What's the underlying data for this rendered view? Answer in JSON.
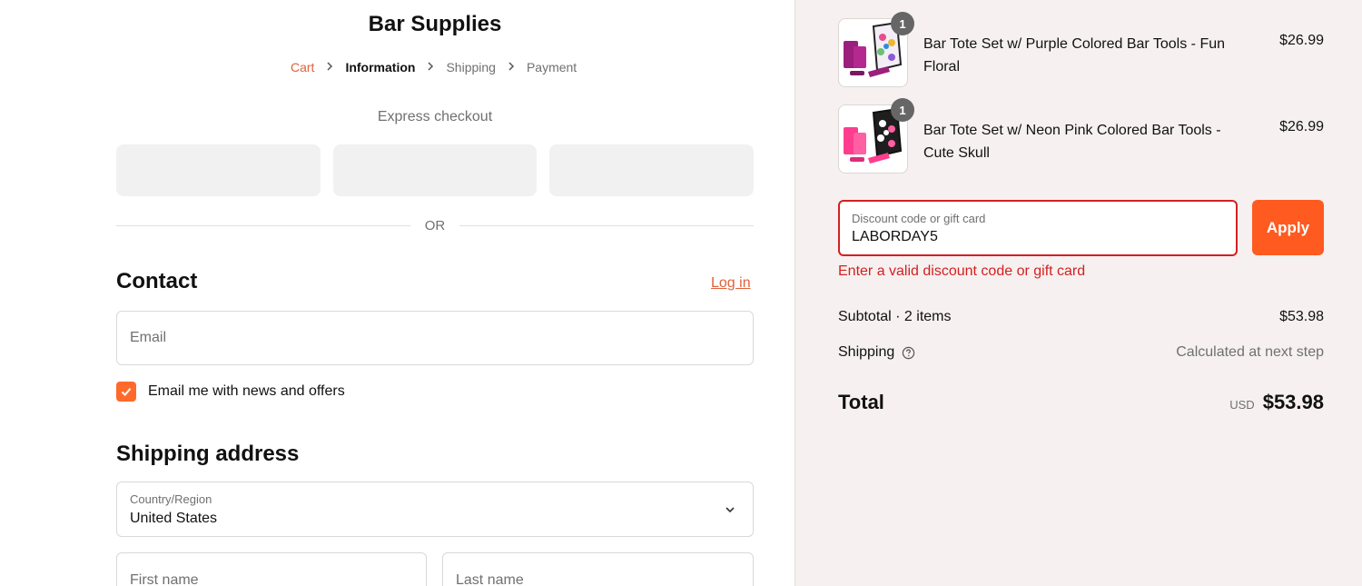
{
  "store": {
    "title": "Bar Supplies"
  },
  "breadcrumb": {
    "cart": "Cart",
    "information": "Information",
    "shipping": "Shipping",
    "payment": "Payment"
  },
  "express": {
    "label": "Express checkout",
    "or": "OR"
  },
  "contact": {
    "title": "Contact",
    "login": "Log in",
    "email_placeholder": "Email",
    "newsletter_label": "Email me with news and offers",
    "newsletter_checked": true
  },
  "shipping_address": {
    "title": "Shipping address",
    "country_label": "Country/Region",
    "country_value": "United States",
    "first_name_placeholder": "First name",
    "last_name_placeholder": "Last name"
  },
  "cart_items": [
    {
      "name": "Bar Tote Set w/ Purple Colored Bar Tools - Fun Floral",
      "price": "$26.99",
      "quantity": "1",
      "accent_color": "#9b1f7d"
    },
    {
      "name": "Bar Tote Set w/ Neon Pink Colored Bar Tools - Cute Skull",
      "price": "$26.99",
      "quantity": "1",
      "accent_color": "#ff3d8e"
    }
  ],
  "discount": {
    "label": "Discount code or gift card",
    "value": "LABORDAY5",
    "apply": "Apply",
    "error": "Enter a valid discount code or gift card"
  },
  "summary": {
    "subtotal_label": "Subtotal · 2 items",
    "subtotal_value": "$53.98",
    "shipping_label": "Shipping",
    "shipping_value": "Calculated at next step",
    "total_label": "Total",
    "currency": "USD",
    "total_value": "$53.98"
  },
  "colors": {
    "accent": "#ff5a1f",
    "link": "#e0613a",
    "error": "#d42020",
    "sidebar_bg": "#f6f1f0"
  }
}
